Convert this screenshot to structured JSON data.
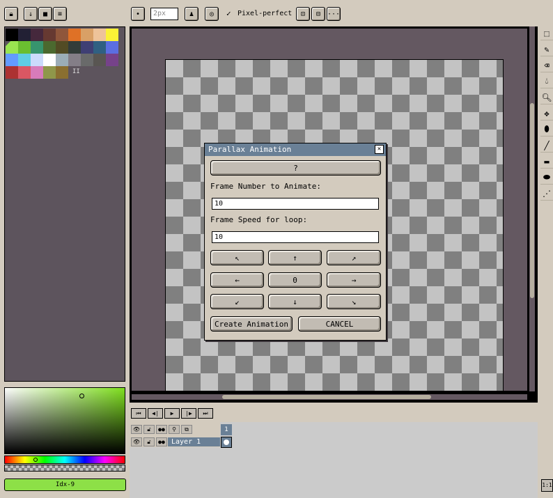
{
  "toolbar": {
    "left_icons": [
      "lock-icon",
      "arrow-down-icon",
      "save-icon",
      "menu-icon"
    ],
    "brush_size": "2px",
    "pixel_perfect_check": "✓",
    "pixel_perfect_label": "Pixel-perfect",
    "more_label": "···"
  },
  "palette": {
    "rows": [
      [
        "#000000",
        "#222034",
        "#45283c",
        "#663931",
        "#8f563b",
        "#df7126",
        "#d9a066",
        "#eec39a",
        "#fbf236"
      ],
      [
        "#99e550",
        "#6abe30",
        "#37946e",
        "#4b692f",
        "#524b24",
        "#323c39",
        "#3f3f74",
        "#306082",
        "#5b6ee1"
      ],
      [
        "#639bff",
        "#5fcde4",
        "#cbdbfc",
        "#ffffff",
        "#9badb7",
        "#847e87",
        "#696a6a",
        "#595652",
        "#76428a"
      ],
      [
        "#ac3232",
        "#d95763",
        "#d77bba",
        "#8f974a",
        "#8a6f30"
      ]
    ],
    "pause_mark": "II"
  },
  "color": {
    "current": "#8de047",
    "index_label": "Idx-9"
  },
  "dialog": {
    "title": "Parallax Animation",
    "close": "✕",
    "help_button": "?",
    "frame_number_label": "Frame Number to Animate:",
    "frame_number_value": "10",
    "frame_speed_label": "Frame Speed for loop:",
    "frame_speed_value": "10",
    "directions": {
      "up_left": "↖",
      "up": "↑",
      "up_right": "↗",
      "left": "←",
      "center": "0",
      "right": "→",
      "down_left": "↙",
      "down": "↓",
      "down_right": "↘"
    },
    "create_button": "Create Animation",
    "cancel_button": "CANCEL"
  },
  "timeline": {
    "controls": [
      "⏮",
      "◀|",
      "▶",
      "|▶",
      "⏭"
    ],
    "frame_number": "1",
    "layer_name": "Layer 1"
  },
  "zoom_label": "1:1",
  "tools": [
    "marquee-icon",
    "pencil-icon",
    "eraser-icon",
    "eyedropper-icon",
    "zoom-icon",
    "move-icon",
    "fill-icon",
    "line-icon",
    "rectangle-icon",
    "ellipse-icon",
    "spray-icon"
  ]
}
